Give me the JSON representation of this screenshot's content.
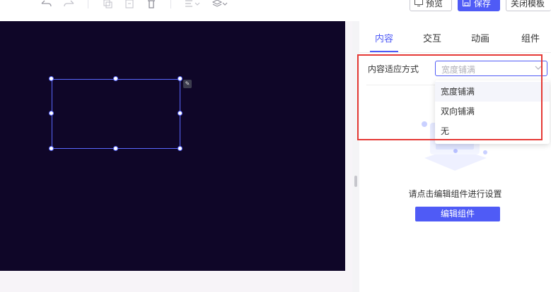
{
  "toolbar": {
    "icons": {
      "undo": "undo-icon",
      "redo": "redo-icon",
      "copy": "copy-icon",
      "paste": "paste-icon",
      "delete": "trash-icon",
      "align": "align-icon",
      "layers": "layers-icon"
    },
    "preview_label": "预览",
    "save_label": "保存",
    "close_label": "关闭模板"
  },
  "panel": {
    "tabs": [
      {
        "label": "内容",
        "active": true
      },
      {
        "label": "交互",
        "active": false
      },
      {
        "label": "动画",
        "active": false
      },
      {
        "label": "组件",
        "active": false
      }
    ],
    "content_fit": {
      "label": "内容适应方式",
      "placeholder": "宽度铺满",
      "options": [
        "宽度铺满",
        "双向铺满",
        "无"
      ]
    },
    "empty_text": "请点击编辑组件进行设置",
    "edit_button_label": "编辑组件"
  },
  "colors": {
    "accent": "#4f5bf6",
    "canvas_bg": "#0f0628",
    "highlight": "#e53935"
  }
}
